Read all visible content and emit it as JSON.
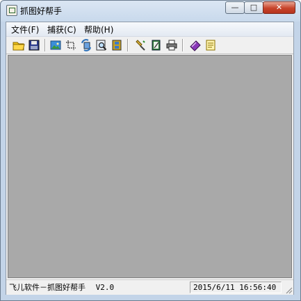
{
  "window": {
    "title": "抓图好帮手",
    "minimize_glyph": "—",
    "maximize_glyph": "□",
    "close_glyph": "✕"
  },
  "menu": {
    "items": [
      {
        "label": "文件(F)"
      },
      {
        "label": "捕获(C)"
      },
      {
        "label": "帮助(H)"
      }
    ]
  },
  "toolbar": {
    "buttons": [
      {
        "icon": "open-folder-icon"
      },
      {
        "icon": "save-disk-icon"
      },
      {
        "icon": "image-icon"
      },
      {
        "icon": "crop-icon"
      },
      {
        "icon": "refresh-capture-icon"
      },
      {
        "icon": "zoom-icon"
      },
      {
        "icon": "film-icon"
      },
      {
        "icon": "paint-brush-icon"
      },
      {
        "icon": "book-edit-icon"
      },
      {
        "icon": "printer-icon"
      },
      {
        "icon": "help-book-icon"
      },
      {
        "icon": "notes-icon"
      }
    ]
  },
  "status": {
    "app_name": "飞儿软件－抓图好帮手",
    "version": "V2.0",
    "datetime": "2015/6/11 16:56:40"
  }
}
